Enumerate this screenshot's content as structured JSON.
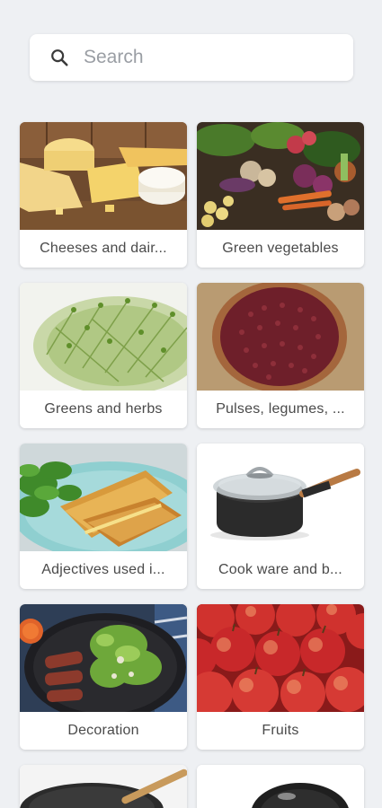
{
  "search": {
    "placeholder": "Search",
    "value": ""
  },
  "categories": [
    {
      "label": "Cheeses and dair..."
    },
    {
      "label": "Green vegetables"
    },
    {
      "label": "Greens and herbs"
    },
    {
      "label": "Pulses, legumes, ..."
    },
    {
      "label": "Adjectives used i..."
    },
    {
      "label": "Cook ware and b..."
    },
    {
      "label": "Decoration"
    },
    {
      "label": "Fruits"
    }
  ]
}
